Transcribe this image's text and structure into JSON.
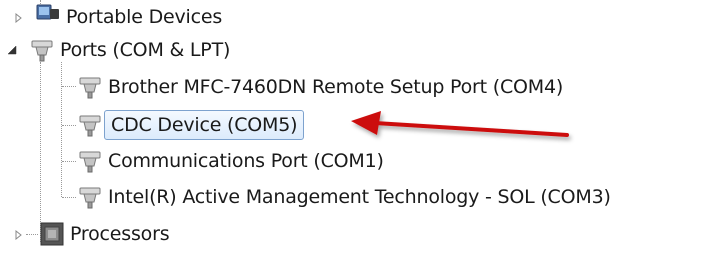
{
  "tree": {
    "portable_devices": {
      "label": "Portable Devices",
      "expander_icon": "collapsed-triangle-icon",
      "icon": "portable-devices-icon"
    },
    "ports": {
      "label": "Ports (COM & LPT)",
      "expander_icon": "expanded-triangle-icon",
      "icon": "port-connector-icon",
      "children": [
        {
          "label": "Brother MFC-7460DN Remote Setup Port (COM4)",
          "icon": "port-connector-icon"
        },
        {
          "label": "CDC Device (COM5)",
          "icon": "port-connector-icon",
          "selected": true
        },
        {
          "label": "Communications Port (COM1)",
          "icon": "port-connector-icon"
        },
        {
          "label": "Intel(R) Active Management Technology - SOL (COM3)",
          "icon": "port-connector-icon"
        }
      ]
    },
    "processors": {
      "label": "Processors",
      "expander_icon": "collapsed-triangle-icon",
      "icon": "processor-chip-icon"
    }
  },
  "annotation": {
    "arrow_color": "#cc1010",
    "arrow_icon": "red-arrow-icon"
  },
  "colors": {
    "selection_border": "#7da2ce",
    "selection_fill": "#dcebfc",
    "text": "#1a1a1a"
  }
}
